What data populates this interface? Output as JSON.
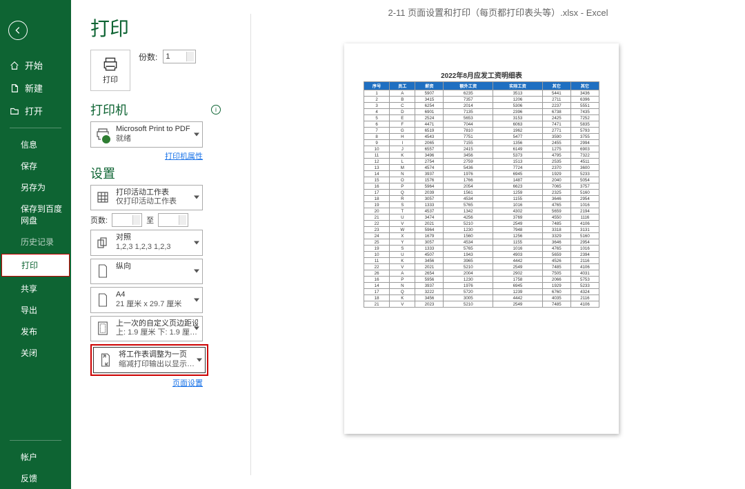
{
  "title": "2-11 页面设置和打印（每页都打印表头等）.xlsx - Excel",
  "page_title": "打印",
  "nav": {
    "home": "开始",
    "new": "新建",
    "open": "打开",
    "info": "信息",
    "save": "保存",
    "saveas": "另存为",
    "save_baidu": "保存到百度网盘",
    "history": "历史记录",
    "print": "打印",
    "share": "共享",
    "export": "导出",
    "publish": "发布",
    "close": "关闭",
    "account": "帐户",
    "feedback": "反馈"
  },
  "print": {
    "print_label": "打印",
    "copies_label": "份数:",
    "copies_value": "1",
    "printer_title": "打印机",
    "printer_name": "Microsoft Print to PDF",
    "printer_status": "就绪",
    "printer_props": "打印机属性",
    "settings_title": "设置",
    "which_sheets_t1": "打印活动工作表",
    "which_sheets_t2": "仅打印活动工作表",
    "pages_label": "页数:",
    "pages_to": "至",
    "collate_t1": "对照",
    "collate_t2": "1,2,3   1,2,3   1,2,3",
    "orient_t1": "纵向",
    "paper_t1": "A4",
    "paper_t2": "21 厘米 x 29.7 厘米",
    "margin_t1": "上一次的自定义页边距设置",
    "margin_t2": "上: 1.9 厘米 下: 1.9 厘米…",
    "scale_t1": "将工作表调整为一页",
    "scale_t2": "缩减打印输出以显示在一…",
    "page_setup": "页面设置"
  },
  "sheet": {
    "title": "2022年8月应发工资明细表",
    "headers": [
      "序号",
      "员工",
      "薪资",
      "额外工资",
      "实际工资",
      "其它"
    ],
    "rows": [
      [
        1,
        "A",
        5907,
        6235,
        3513,
        5441,
        3436
      ],
      [
        2,
        "B",
        3415,
        7357,
        1206,
        2711,
        6396
      ],
      [
        3,
        "C",
        6254,
        2014,
        5306,
        2237,
        5551
      ],
      [
        4,
        "D",
        6901,
        7135,
        2396,
        6738,
        7435
      ],
      [
        5,
        "E",
        2524,
        5653,
        3153,
        2425,
        7252
      ],
      [
        6,
        "F",
        4471,
        7044,
        6063,
        7471,
        5835
      ],
      [
        7,
        "G",
        6519,
        7810,
        1962,
        2771,
        5793
      ],
      [
        8,
        "H",
        4543,
        7751,
        5477,
        3590,
        3755
      ],
      [
        9,
        "I",
        2065,
        7155,
        1356,
        2455,
        2994
      ],
      [
        10,
        "J",
        6557,
        2415,
        6149,
        1275,
        6903
      ],
      [
        11,
        "K",
        3496,
        3456,
        5373,
        4795,
        7322
      ],
      [
        12,
        "L",
        2754,
        2759,
        1513,
        2535,
        4511
      ],
      [
        13,
        "M",
        4574,
        5436,
        7724,
        2370,
        3600
      ],
      [
        14,
        "N",
        3937,
        1976,
        6945,
        1929,
        5233
      ],
      [
        15,
        "O",
        1576,
        1766,
        1487,
        2040,
        5054
      ],
      [
        16,
        "P",
        5964,
        2054,
        6623,
        7065,
        3757
      ],
      [
        17,
        "Q",
        2039,
        1561,
        1259,
        2325,
        5160
      ],
      [
        18,
        "R",
        3057,
        4534,
        1155,
        3646,
        2954
      ],
      [
        19,
        "S",
        1333,
        5765,
        1016,
        4765,
        1016
      ],
      [
        20,
        "T",
        4537,
        1342,
        4302,
        5659,
        2194
      ],
      [
        21,
        "U",
        3474,
        4256,
        3769,
        4550,
        1116
      ],
      [
        22,
        "V",
        2021,
        5210,
        2549,
        7485,
        4106
      ],
      [
        23,
        "W",
        5964,
        1230,
        7948,
        3318,
        3131
      ],
      [
        24,
        "X",
        1679,
        1560,
        1256,
        3329,
        5160
      ],
      [
        25,
        "Y",
        3057,
        4534,
        1155,
        3646,
        2954
      ],
      [
        19,
        "S",
        1333,
        5765,
        1016,
        4765,
        1016
      ],
      [
        10,
        "U",
        4507,
        1943,
        4903,
        5659,
        2394
      ],
      [
        11,
        "K",
        3456,
        3965,
        4442,
        4526,
        2116
      ],
      [
        22,
        "V",
        2021,
        5210,
        2549,
        7485,
        4106
      ],
      [
        26,
        "A",
        2654,
        2004,
        2902,
        7505,
        4031
      ],
      [
        16,
        "P",
        5956,
        1230,
        1758,
        2066,
        5753
      ],
      [
        14,
        "N",
        3937,
        1976,
        6945,
        1929,
        5233
      ],
      [
        17,
        "Q",
        3222,
        5720,
        1239,
        6760,
        4324
      ],
      [
        18,
        "K",
        3456,
        3005,
        4442,
        4035,
        2116
      ],
      [
        21,
        "V",
        2023,
        5210,
        2549,
        7485,
        4106
      ]
    ]
  }
}
